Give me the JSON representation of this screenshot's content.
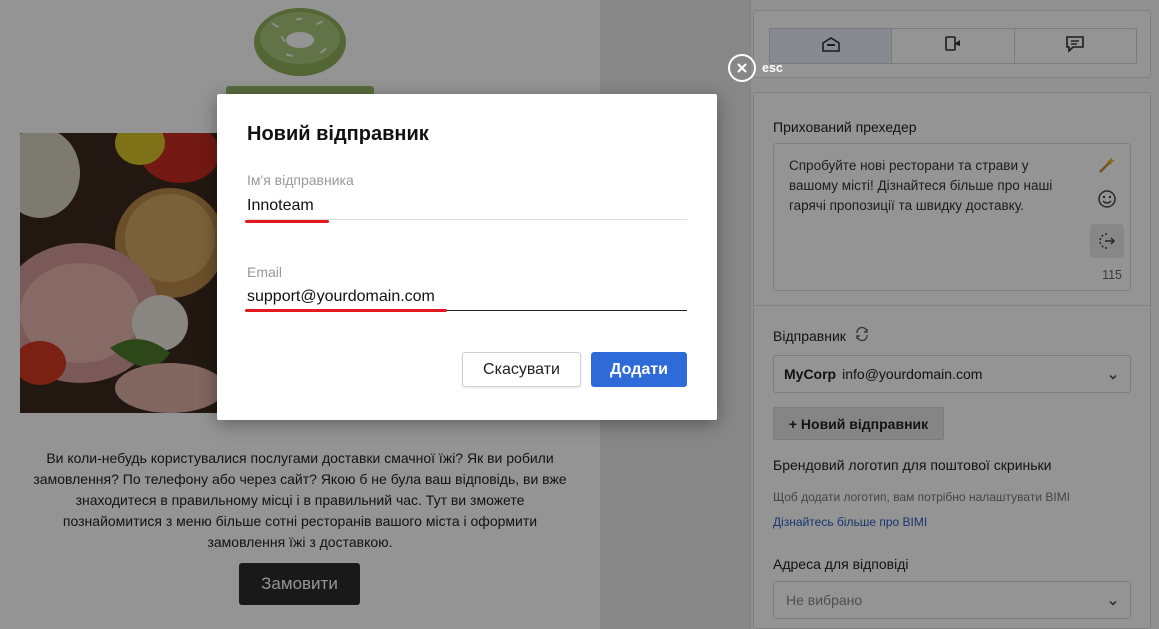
{
  "preview": {
    "promo_text": "Ви коли-небудь користувалися послугами доставки смачної їжі? Як ви робили замовлення? По телефону або через сайт? Якою б не була ваш відповідь, ви вже знаходитеся в правильному місці і в правильний час. Тут ви зможете познайомитися з меню більше сотні ресторанів вашого міста і оформити замовлення їжі з доставкою.",
    "order_button": "Замовити"
  },
  "panel": {
    "preheader_label": "Прихований прехедер",
    "preheader_text": "Спробуйте нові ресторани та страви у вашому місті! Дізнайтеся більше про наші гарячі пропозиції та швидку доставку.",
    "char_count": "115",
    "sender_label": "Відправник",
    "sender_name": "MyCorp",
    "sender_email": "info@yourdomain.com",
    "new_sender_button": "+ Новий відправник",
    "brand_logo_label": "Брендовий логотип для поштової скриньки",
    "bimi_hint": "Щоб додати логотип, вам потрібно налаштувати BIMI",
    "bimi_link": "Дізнайтесь більше про BIMI",
    "reply_label": "Адреса для відповіді",
    "reply_placeholder": "Не вибрано"
  },
  "close": {
    "label": "esc"
  },
  "modal": {
    "title": "Новий відправник",
    "name_label": "Ім'я відправника",
    "name_value": "Innoteam",
    "email_label": "Email",
    "email_value": "support@yourdomain.com",
    "cancel_button": "Скасувати",
    "add_button": "Додати"
  },
  "colors": {
    "accent": "#2f6bd8",
    "highlight_underline": "#e3191f",
    "logo_green": "#8fb05a"
  }
}
